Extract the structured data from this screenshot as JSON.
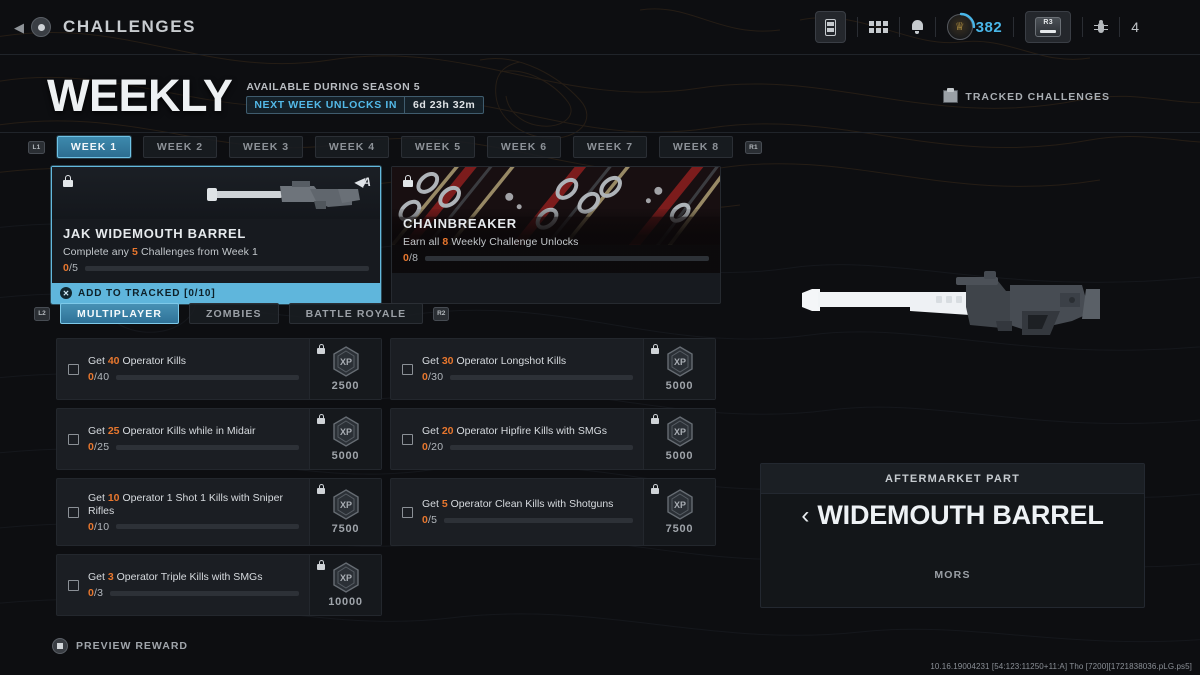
{
  "topbar": {
    "back_icon": "chevron-left-icon",
    "circle_icon": "circle-button-icon",
    "title": "CHALLENGES",
    "hud": {
      "battery_icon": "battery-icon",
      "grid_icon": "grid-icon",
      "bell_icon": "bell-icon",
      "rank_icon": "rank-emblem-icon",
      "rank_level": "382",
      "r3_label": "R3",
      "bug_icon": "bug-icon",
      "count": "4"
    }
  },
  "header": {
    "title": "WEEKLY",
    "availability": "AVAILABLE DURING SEASON 5",
    "unlock_label": "NEXT WEEK UNLOCKS IN",
    "unlock_time": "6d 23h 32m",
    "tracked_challenges": "TRACKED CHALLENGES",
    "tracked_icon": "clipboard-icon"
  },
  "week_tabs": {
    "left_bumper": "L1",
    "right_bumper": "R1",
    "items": [
      {
        "label": "WEEK 1",
        "active": true
      },
      {
        "label": "WEEK 2",
        "active": false
      },
      {
        "label": "WEEK 3",
        "active": false
      },
      {
        "label": "WEEK 4",
        "active": false
      },
      {
        "label": "WEEK 5",
        "active": false
      },
      {
        "label": "WEEK 6",
        "active": false
      },
      {
        "label": "WEEK 7",
        "active": false
      },
      {
        "label": "WEEK 8",
        "active": false
      }
    ]
  },
  "reward_cards": [
    {
      "name": "JAK WIDEMOUTH BARREL",
      "desc_prefix": "Complete any ",
      "desc_number": "5",
      "desc_suffix": " Challenges from Week 1",
      "progress_current": "0",
      "progress_total": "/5",
      "progress_pct": 0,
      "lock_icon": "lock-icon",
      "badge_icon": "aftermarket-part-icon",
      "cta_label": "ADD TO TRACKED [0/10]",
      "cta_button_icon": "cross-button-icon",
      "selected": true
    },
    {
      "name": "CHAINBREAKER",
      "desc_prefix": "Earn all ",
      "desc_number": "8",
      "desc_suffix": " Weekly Challenge Unlocks",
      "progress_current": "0",
      "progress_total": "/8",
      "progress_pct": 0,
      "lock_icon": "lock-icon",
      "selected": false
    }
  ],
  "mode_tabs": {
    "left_trigger": "L2",
    "right_trigger": "R2",
    "items": [
      {
        "label": "MULTIPLAYER",
        "active": true
      },
      {
        "label": "ZOMBIES",
        "active": false
      },
      {
        "label": "BATTLE ROYALE",
        "active": false
      }
    ]
  },
  "challenges": [
    {
      "prefix": "Get ",
      "number": "40",
      "suffix": " Operator Kills",
      "current": "0",
      "total": "/40",
      "progress_pct": 0,
      "xp": "2500",
      "lock_icon": "lock-icon",
      "xp_icon": "xp-hex-icon",
      "tall": false
    },
    {
      "prefix": "Get ",
      "number": "30",
      "suffix": " Operator Longshot Kills",
      "current": "0",
      "total": "/30",
      "progress_pct": 0,
      "xp": "5000",
      "lock_icon": "lock-icon",
      "xp_icon": "xp-hex-icon",
      "tall": false
    },
    {
      "prefix": "Get ",
      "number": "25",
      "suffix": " Operator Kills while in Midair",
      "current": "0",
      "total": "/25",
      "progress_pct": 0,
      "xp": "5000",
      "lock_icon": "lock-icon",
      "xp_icon": "xp-hex-icon",
      "tall": false
    },
    {
      "prefix": "Get ",
      "number": "20",
      "suffix": " Operator Hipfire Kills with SMGs",
      "current": "0",
      "total": "/20",
      "progress_pct": 0,
      "xp": "5000",
      "lock_icon": "lock-icon",
      "xp_icon": "xp-hex-icon",
      "tall": false
    },
    {
      "prefix": "Get ",
      "number": "10",
      "suffix": " Operator 1 Shot 1 Kills with Sniper Rifles",
      "current": "0",
      "total": "/10",
      "progress_pct": 0,
      "xp": "7500",
      "lock_icon": "lock-icon",
      "xp_icon": "xp-hex-icon",
      "tall": true
    },
    {
      "prefix": "Get ",
      "number": "5",
      "suffix": " Operator Clean Kills with Shotguns",
      "current": "0",
      "total": "/5",
      "progress_pct": 0,
      "xp": "7500",
      "lock_icon": "lock-icon",
      "xp_icon": "xp-hex-icon",
      "tall": true
    },
    {
      "prefix": "Get ",
      "number": "3",
      "suffix": " Operator Triple Kills with SMGs",
      "current": "0",
      "total": "/3",
      "progress_pct": 0,
      "xp": "10000",
      "lock_icon": "lock-icon",
      "xp_icon": "xp-hex-icon",
      "tall": false
    }
  ],
  "detail_panel": {
    "kicker": "AFTERMARKET PART",
    "chevron": "‹",
    "name": "WIDEMOUTH BARREL",
    "weapon": "MORS",
    "weapon_icon": "sniper-rifle-icon"
  },
  "footer": {
    "preview_label": "PREVIEW REWARD",
    "preview_icon": "square-button-icon",
    "build_string": "10.16.19004231 [54:123:11250+11:A] Tho [7200][1721838036.pLG.ps5]"
  },
  "colors": {
    "accent_blue": "#63b9dd",
    "highlight_orange": "#e8772e",
    "panel_bg": "#1b1e23",
    "page_bg": "#0d0e11"
  }
}
